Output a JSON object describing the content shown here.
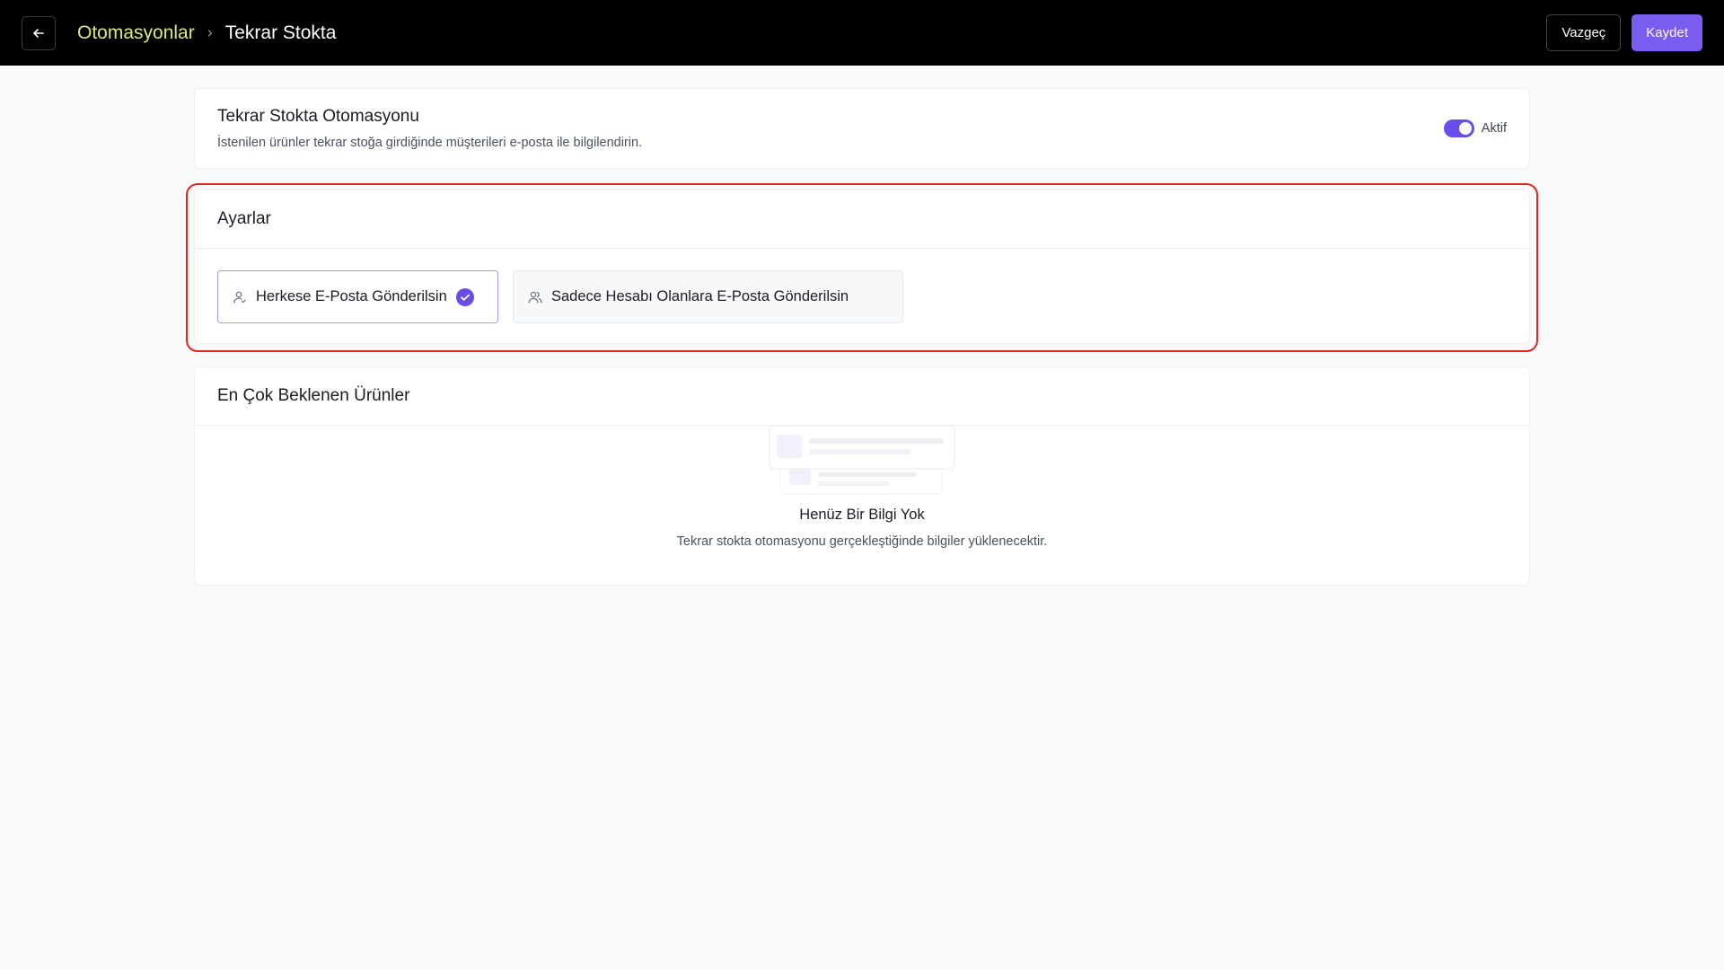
{
  "header": {
    "back_icon": "arrow-left-icon",
    "breadcrumb_parent": "Otomasyonlar",
    "breadcrumb_current": "Tekrar Stokta",
    "cancel_label": "Vazgeç",
    "save_label": "Kaydet"
  },
  "automation": {
    "title": "Tekrar Stokta Otomasyonu",
    "description": "İstenilen ürünler tekrar stoğa girdiğinde müşterileri e-posta ile bilgilendirin.",
    "status_label": "Aktif",
    "enabled": true
  },
  "settings": {
    "title": "Ayarlar",
    "options": [
      {
        "label": "Herkese E-Posta Gönderilsin",
        "icon": "user-icon",
        "selected": true
      },
      {
        "label": "Sadece Hesabı Olanlara E-Posta Gönderilsin",
        "icon": "users-icon",
        "selected": false
      }
    ]
  },
  "products": {
    "title": "En Çok Beklenen Ürünler",
    "empty_title": "Henüz Bir Bilgi Yok",
    "empty_desc": "Tekrar stokta otomasyonu gerçekleştiğinde bilgiler yüklenecektir."
  },
  "colors": {
    "accent": "#7b5cf0",
    "breadcrumb_link": "#d8ec7a",
    "highlight": "#e1261c"
  }
}
